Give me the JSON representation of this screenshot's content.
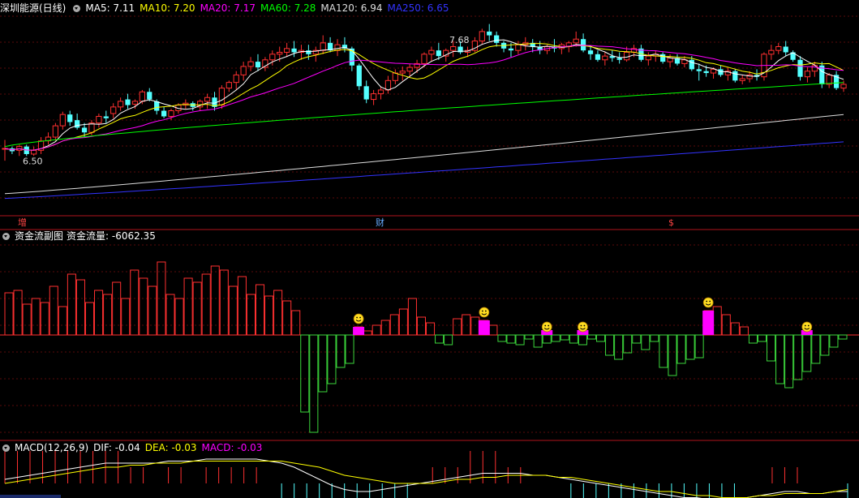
{
  "header": {
    "title": "深圳能源(日线)",
    "ma": [
      {
        "label": "MA5: 7.11",
        "color": "#ffffff"
      },
      {
        "label": "MA10: 7.20",
        "color": "#ffff00"
      },
      {
        "label": "MA20: 7.17",
        "color": "#ff00ff"
      },
      {
        "label": "MA60: 7.28",
        "color": "#00ff00"
      },
      {
        "label": "MA120: 6.94",
        "color": "#dddddd"
      },
      {
        "label": "MA250: 6.65",
        "color": "#3333ff"
      }
    ]
  },
  "events": [
    {
      "label": "增",
      "color": "#ff4444"
    },
    {
      "label": "财",
      "color": "#66aaff"
    },
    {
      "label": "$",
      "color": "#ff4444"
    }
  ],
  "fund": {
    "title": "资金流副图",
    "value": "资金流量: -6062.35"
  },
  "macd": {
    "title": "MACD(12,26,9)",
    "dif": "DIF: -0.04",
    "dea": "DEA: -0.03",
    "macd": "MACD: -0.03"
  },
  "colors": {
    "up": "#ff3030",
    "down": "#54ffff",
    "border": "#b0141c",
    "magenta": "#ff00ff",
    "green": "#3bd63b"
  },
  "chart_data": {
    "type": "candlestick",
    "price_annotations": [
      {
        "label": "7.68",
        "value": 7.68
      },
      {
        "label": "6.50",
        "value": 6.5
      }
    ],
    "ylim": [
      5.9,
      8.0
    ],
    "candles": [
      [
        6.58,
        6.67,
        6.45,
        6.58
      ],
      [
        6.58,
        6.6,
        6.52,
        6.55
      ],
      [
        6.56,
        6.62,
        6.5,
        6.6
      ],
      [
        6.6,
        6.62,
        6.5,
        6.52
      ],
      [
        6.52,
        6.6,
        6.5,
        6.56
      ],
      [
        6.56,
        6.7,
        6.52,
        6.66
      ],
      [
        6.66,
        6.75,
        6.62,
        6.7
      ],
      [
        6.7,
        6.85,
        6.66,
        6.82
      ],
      [
        6.82,
        6.97,
        6.78,
        6.94
      ],
      [
        6.94,
        6.98,
        6.82,
        6.86
      ],
      [
        6.88,
        6.95,
        6.78,
        6.8
      ],
      [
        6.8,
        6.85,
        6.7,
        6.75
      ],
      [
        6.75,
        6.88,
        6.72,
        6.85
      ],
      [
        6.85,
        6.95,
        6.8,
        6.92
      ],
      [
        6.92,
        6.98,
        6.85,
        6.9
      ],
      [
        6.95,
        7.06,
        6.9,
        7.02
      ],
      [
        7.02,
        7.12,
        6.98,
        7.08
      ],
      [
        7.1,
        7.16,
        7.0,
        7.04
      ],
      [
        7.05,
        7.1,
        7.0,
        7.08
      ],
      [
        7.08,
        7.2,
        7.05,
        7.18
      ],
      [
        7.18,
        7.22,
        7.08,
        7.1
      ],
      [
        7.08,
        7.1,
        6.94,
        6.98
      ],
      [
        6.98,
        7.02,
        6.9,
        6.92
      ],
      [
        6.92,
        7.0,
        6.88,
        6.98
      ],
      [
        6.98,
        7.06,
        6.95,
        7.04
      ],
      [
        7.04,
        7.1,
        7.0,
        7.06
      ],
      [
        7.06,
        7.08,
        6.98,
        7.02
      ],
      [
        7.02,
        7.1,
        6.98,
        7.08
      ],
      [
        7.08,
        7.16,
        7.0,
        7.12
      ],
      [
        7.12,
        7.18,
        6.98,
        7.02
      ],
      [
        7.04,
        7.25,
        7.0,
        7.22
      ],
      [
        7.22,
        7.3,
        7.18,
        7.28
      ],
      [
        7.28,
        7.4,
        7.2,
        7.36
      ],
      [
        7.36,
        7.5,
        7.3,
        7.45
      ],
      [
        7.45,
        7.55,
        7.4,
        7.5
      ],
      [
        7.5,
        7.58,
        7.4,
        7.44
      ],
      [
        7.44,
        7.55,
        7.4,
        7.52
      ],
      [
        7.52,
        7.62,
        7.46,
        7.58
      ],
      [
        7.58,
        7.66,
        7.5,
        7.6
      ],
      [
        7.6,
        7.7,
        7.55,
        7.64
      ],
      [
        7.64,
        7.72,
        7.55,
        7.6
      ],
      [
        7.6,
        7.68,
        7.52,
        7.62
      ],
      [
        7.62,
        7.68,
        7.52,
        7.58
      ],
      [
        7.58,
        7.66,
        7.5,
        7.62
      ],
      [
        7.62,
        7.78,
        7.58,
        7.7
      ],
      [
        7.7,
        7.76,
        7.6,
        7.62
      ],
      [
        7.62,
        7.74,
        7.56,
        7.68
      ],
      [
        7.68,
        7.76,
        7.6,
        7.64
      ],
      [
        7.64,
        7.66,
        7.4,
        7.46
      ],
      [
        7.46,
        7.48,
        7.2,
        7.24
      ],
      [
        7.24,
        7.3,
        7.06,
        7.1
      ],
      [
        7.1,
        7.2,
        7.04,
        7.16
      ],
      [
        7.16,
        7.24,
        7.1,
        7.2
      ],
      [
        7.2,
        7.35,
        7.16,
        7.3
      ],
      [
        7.3,
        7.42,
        7.26,
        7.38
      ],
      [
        7.38,
        7.45,
        7.3,
        7.4
      ],
      [
        7.4,
        7.48,
        7.35,
        7.44
      ],
      [
        7.44,
        7.52,
        7.38,
        7.48
      ],
      [
        7.48,
        7.6,
        7.44,
        7.58
      ],
      [
        7.58,
        7.66,
        7.5,
        7.62
      ],
      [
        7.62,
        7.7,
        7.52,
        7.56
      ],
      [
        7.56,
        7.64,
        7.5,
        7.62
      ],
      [
        7.62,
        7.72,
        7.55,
        7.66
      ],
      [
        7.66,
        7.72,
        7.58,
        7.6
      ],
      [
        7.6,
        7.66,
        7.55,
        7.62
      ],
      [
        7.62,
        7.76,
        7.6,
        7.72
      ],
      [
        7.72,
        7.85,
        7.68,
        7.82
      ],
      [
        7.82,
        7.9,
        7.72,
        7.78
      ],
      [
        7.78,
        7.82,
        7.66,
        7.7
      ],
      [
        7.7,
        7.72,
        7.6,
        7.64
      ],
      [
        7.64,
        7.7,
        7.55,
        7.62
      ],
      [
        7.62,
        7.72,
        7.58,
        7.68
      ],
      [
        7.68,
        7.76,
        7.62,
        7.7
      ],
      [
        7.7,
        7.74,
        7.6,
        7.66
      ],
      [
        7.66,
        7.72,
        7.58,
        7.62
      ],
      [
        7.62,
        7.68,
        7.58,
        7.66
      ],
      [
        7.66,
        7.74,
        7.6,
        7.64
      ],
      [
        7.64,
        7.7,
        7.58,
        7.68
      ],
      [
        7.66,
        7.72,
        7.6,
        7.7
      ],
      [
        7.7,
        7.82,
        7.66,
        7.74
      ],
      [
        7.74,
        7.8,
        7.6,
        7.62
      ],
      [
        7.62,
        7.66,
        7.52,
        7.58
      ],
      [
        7.58,
        7.62,
        7.5,
        7.52
      ],
      [
        7.52,
        7.6,
        7.46,
        7.56
      ],
      [
        7.56,
        7.62,
        7.5,
        7.54
      ],
      [
        7.54,
        7.6,
        7.48,
        7.52
      ],
      [
        7.52,
        7.66,
        7.5,
        7.6
      ],
      [
        7.6,
        7.68,
        7.55,
        7.64
      ],
      [
        7.64,
        7.68,
        7.5,
        7.52
      ],
      [
        7.52,
        7.6,
        7.46,
        7.56
      ],
      [
        7.56,
        7.62,
        7.5,
        7.58
      ],
      [
        7.58,
        7.6,
        7.48,
        7.5
      ],
      [
        7.5,
        7.58,
        7.44,
        7.54
      ],
      [
        7.54,
        7.58,
        7.46,
        7.48
      ],
      [
        7.48,
        7.56,
        7.44,
        7.52
      ],
      [
        7.52,
        7.56,
        7.4,
        7.42
      ],
      [
        7.42,
        7.48,
        7.3,
        7.4
      ],
      [
        7.4,
        7.46,
        7.34,
        7.38
      ],
      [
        7.38,
        7.44,
        7.32,
        7.42
      ],
      [
        7.42,
        7.46,
        7.34,
        7.36
      ],
      [
        7.36,
        7.44,
        7.3,
        7.4
      ],
      [
        7.4,
        7.42,
        7.28,
        7.3
      ],
      [
        7.3,
        7.36,
        7.26,
        7.32
      ],
      [
        7.32,
        7.4,
        7.28,
        7.36
      ],
      [
        7.36,
        7.42,
        7.3,
        7.34
      ],
      [
        7.34,
        7.6,
        7.3,
        7.58
      ],
      [
        7.58,
        7.68,
        7.52,
        7.62
      ],
      [
        7.62,
        7.7,
        7.58,
        7.66
      ],
      [
        7.66,
        7.72,
        7.56,
        7.6
      ],
      [
        7.6,
        7.62,
        7.5,
        7.52
      ],
      [
        7.52,
        7.56,
        7.3,
        7.34
      ],
      [
        7.34,
        7.44,
        7.28,
        7.4
      ],
      [
        7.4,
        7.5,
        7.34,
        7.46
      ],
      [
        7.46,
        7.5,
        7.22,
        7.26
      ],
      [
        7.26,
        7.38,
        7.22,
        7.36
      ],
      [
        7.36,
        7.4,
        7.2,
        7.22
      ],
      [
        7.22,
        7.3,
        7.18,
        7.26
      ]
    ],
    "fund_flow": [
      52,
      55,
      38,
      45,
      40,
      60,
      35,
      75,
      68,
      40,
      55,
      50,
      65,
      45,
      80,
      70,
      60,
      90,
      50,
      45,
      70,
      65,
      75,
      85,
      80,
      60,
      72,
      50,
      62,
      48,
      55,
      42,
      30,
      -95,
      -120,
      -70,
      -60,
      -40,
      -35,
      10,
      5,
      12,
      18,
      25,
      32,
      45,
      22,
      15,
      -10,
      -12,
      20,
      25,
      22,
      18,
      12,
      -8,
      -10,
      -12,
      -5,
      -15,
      -10,
      -8,
      -6,
      -10,
      -12,
      -5,
      -8,
      -25,
      -30,
      -22,
      -10,
      -18,
      -8,
      -40,
      -50,
      -35,
      -30,
      -28,
      30,
      35,
      25,
      15,
      10,
      -10,
      -8,
      -32,
      -60,
      -65,
      -55,
      -45,
      -35,
      -25,
      -15,
      -5
    ],
    "fund_markers": [
      39,
      53,
      60,
      64,
      78,
      89
    ],
    "macd_dif": [
      0.02,
      0.03,
      0.04,
      0.05,
      0.06,
      0.07,
      0.08,
      0.09,
      0.1,
      0.1,
      0.1,
      0.1,
      0.1,
      0.11,
      0.11,
      0.11,
      0.12,
      0.12,
      0.12,
      0.12,
      0.12,
      0.11,
      0.1,
      0.08,
      0.05,
      0.02,
      -0.01,
      -0.03,
      -0.04,
      -0.04,
      -0.03,
      -0.02,
      -0.01,
      0.0,
      0.01,
      0.02,
      0.03,
      0.04,
      0.05,
      0.05,
      0.05,
      0.05,
      0.04,
      0.04,
      0.03,
      0.02,
      0.01,
      0.0,
      -0.01,
      -0.02,
      -0.03,
      -0.04,
      -0.05,
      -0.06,
      -0.07,
      -0.07,
      -0.08,
      -0.08,
      -0.08,
      -0.07,
      -0.06,
      -0.05,
      -0.04,
      -0.04,
      -0.05,
      -0.05,
      -0.04,
      -0.04
    ],
    "macd_dea": [
      0.0,
      0.01,
      0.02,
      0.03,
      0.04,
      0.05,
      0.06,
      0.07,
      0.08,
      0.08,
      0.09,
      0.09,
      0.1,
      0.1,
      0.1,
      0.11,
      0.11,
      0.11,
      0.11,
      0.11,
      0.11,
      0.11,
      0.11,
      0.1,
      0.09,
      0.08,
      0.06,
      0.04,
      0.03,
      0.02,
      0.01,
      0.0,
      0.0,
      0.0,
      0.0,
      0.01,
      0.02,
      0.02,
      0.03,
      0.03,
      0.04,
      0.04,
      0.04,
      0.04,
      0.03,
      0.03,
      0.02,
      0.01,
      0.0,
      -0.01,
      -0.02,
      -0.03,
      -0.04,
      -0.04,
      -0.05,
      -0.06,
      -0.06,
      -0.07,
      -0.07,
      -0.07,
      -0.06,
      -0.06,
      -0.05,
      -0.05,
      -0.05,
      -0.05,
      -0.04,
      -0.03
    ]
  }
}
